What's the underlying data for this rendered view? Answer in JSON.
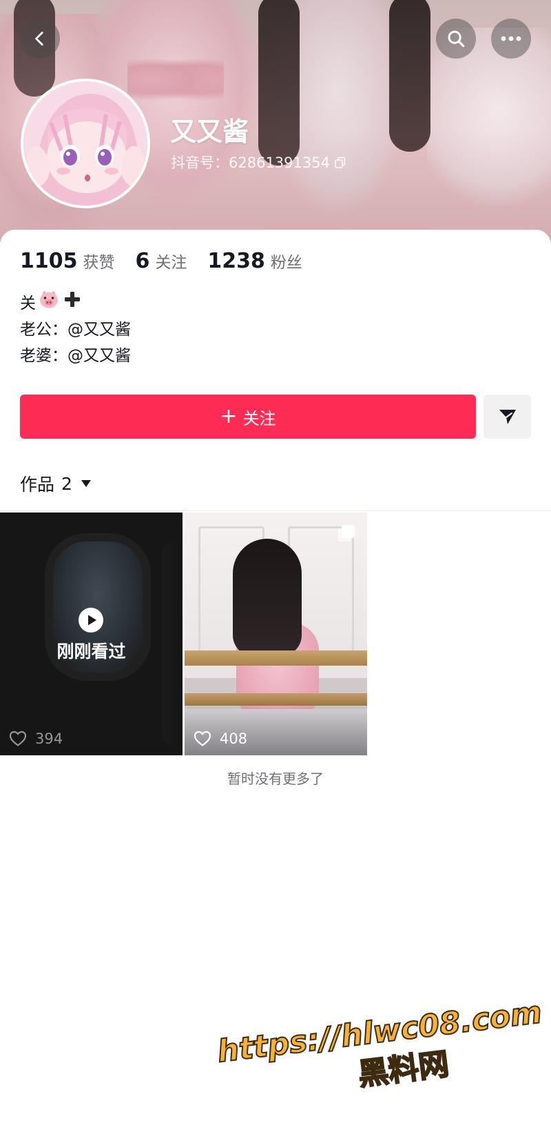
{
  "header": {
    "back_icon": "chevron-left-icon",
    "search_icon": "search-icon",
    "more_icon": "ellipsis-icon"
  },
  "profile": {
    "username": "又又酱",
    "douyin_id": "抖音号：62861391354",
    "copy_icon": "copy-icon"
  },
  "stats": [
    {
      "value": "1105",
      "label": "获赞"
    },
    {
      "value": "6",
      "label": "关注"
    },
    {
      "value": "1238",
      "label": "粉丝"
    }
  ],
  "bio": {
    "line1": "关",
    "line1_icons": [
      "pig-face-icon",
      "plus-icon"
    ],
    "line2": "老公：@又又酱",
    "line3": "老婆：@又又酱"
  },
  "actions": {
    "follow_label": "关注",
    "follow_prefix": "+",
    "share_icon": "send-icon"
  },
  "works_tab": {
    "label": "作品",
    "count": "2",
    "caret_icon": "caret-down-icon"
  },
  "videos": [
    {
      "overlay_label": "刚刚看过",
      "likes": "394",
      "icon": "play-icon"
    },
    {
      "likes": "408",
      "icon": "multi-image-icon"
    }
  ],
  "end_text": "暂时没有更多了",
  "watermark": {
    "url": "https://hlwc08.com",
    "name": "黑料网"
  },
  "colors": {
    "follow_button": "#fe2c55",
    "share_button": "#f1f1f2",
    "primary_text": "#161823",
    "secondary_text": "#6f6f78",
    "watermark": "#f4b238"
  }
}
